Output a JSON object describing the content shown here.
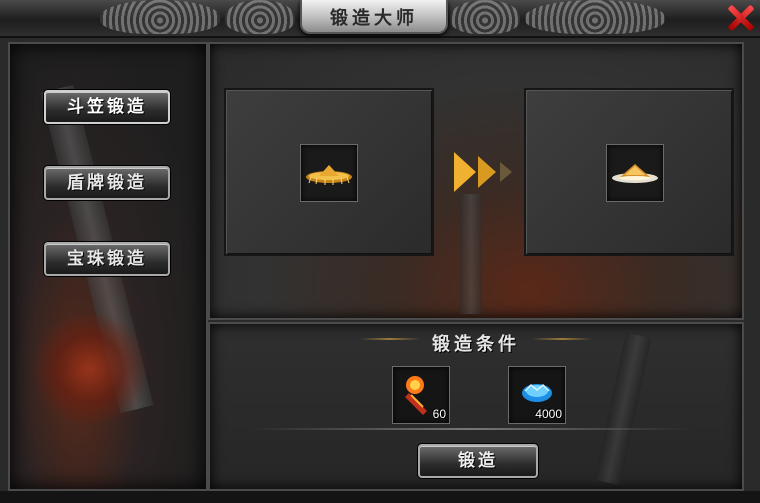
{
  "window": {
    "title": "锻造大师",
    "close_icon": "close-x-icon",
    "accent_close": "#d01010"
  },
  "tabs": [
    {
      "label": "斗笠锻造",
      "active": true
    },
    {
      "label": "盾牌锻造",
      "active": false
    },
    {
      "label": "宝珠锻造",
      "active": false
    }
  ],
  "forge": {
    "source_item_icon": "golden-straw-hat-icon",
    "arrow_icon": "double-chevron-right-icon",
    "result_item_icon": "glowing-straw-hat-icon",
    "arrow_color": "#f0b030"
  },
  "conditions": {
    "title": "锻造条件",
    "materials": [
      {
        "icon": "fire-scroll-icon",
        "quantity": "60"
      },
      {
        "icon": "blue-crystal-icon",
        "quantity": "4000"
      }
    ]
  },
  "actions": {
    "forge_label": "锻造"
  }
}
